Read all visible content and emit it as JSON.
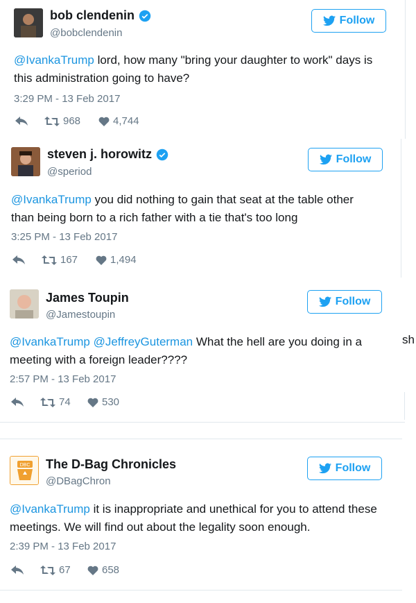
{
  "follow_label": "Follow",
  "stray_text": "sh",
  "tweets": [
    {
      "name": "bob clendenin",
      "verified": true,
      "handle": "@bobclendenin",
      "mentions": [
        "@IvankaTrump"
      ],
      "text": " lord, how many \"bring your daughter to work\" days is this administration going to have?",
      "time": "3:29 PM - 13 Feb 2017",
      "retweets": "968",
      "likes": "4,744"
    },
    {
      "name": "steven j. horowitz",
      "verified": true,
      "handle": "@speriod",
      "mentions": [
        "@IvankaTrump"
      ],
      "text": " you did nothing to gain that seat at the table other than being born to a rich father with a tie that's too long",
      "time": "3:25 PM - 13 Feb 2017",
      "retweets": "167",
      "likes": "1,494"
    },
    {
      "name": "James Toupin",
      "verified": false,
      "handle": "@Jamestoupin",
      "mentions": [
        "@IvankaTrump",
        "@JeffreyGuterman"
      ],
      "text": " What the hell are you doing in a meeting with a foreign leader????",
      "time": "2:57 PM - 13 Feb 2017",
      "retweets": "74",
      "likes": "530"
    },
    {
      "name": "The D-Bag Chronicles",
      "verified": false,
      "handle": "@DBagChron",
      "mentions": [
        "@IvankaTrump"
      ],
      "text": " it is inappropriate and unethical for you to attend these meetings. We will find out about the legality soon enough.",
      "time": "2:39 PM - 13 Feb 2017",
      "retweets": "67",
      "likes": "658",
      "avatar_text": "DBC"
    }
  ]
}
